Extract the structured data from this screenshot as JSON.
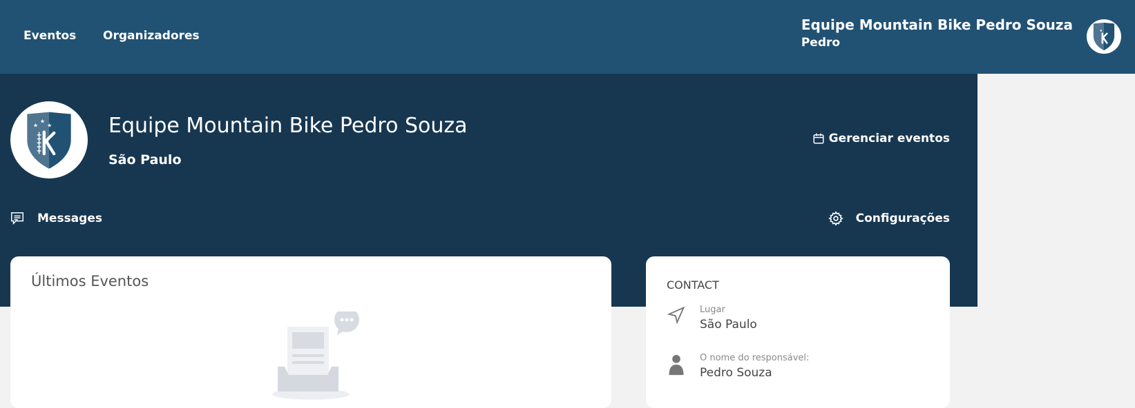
{
  "nav": {
    "items": [
      {
        "label": "Eventos"
      },
      {
        "label": "Organizadores"
      }
    ]
  },
  "user": {
    "team": "Equipe Mountain Bike Pedro Souza",
    "name": "Pedro"
  },
  "hero": {
    "title": "Equipe Mountain Bike Pedro Souza",
    "city": "São Paulo",
    "manage_events": "Gerenciar eventos",
    "messages": "Messages",
    "settings": "Configurações"
  },
  "events_card": {
    "title": "Últimos Eventos"
  },
  "contact": {
    "heading": "CONTACT",
    "place_label": "Lugar",
    "place_value": "São Paulo",
    "person_label": "O nome do responsável:",
    "person_value": "Pedro Souza"
  },
  "colors": {
    "topbar": "#215274",
    "hero": "#173751",
    "shield_light": "#4f7591",
    "shield_dark": "#215274",
    "background": "#f2f2f2"
  }
}
